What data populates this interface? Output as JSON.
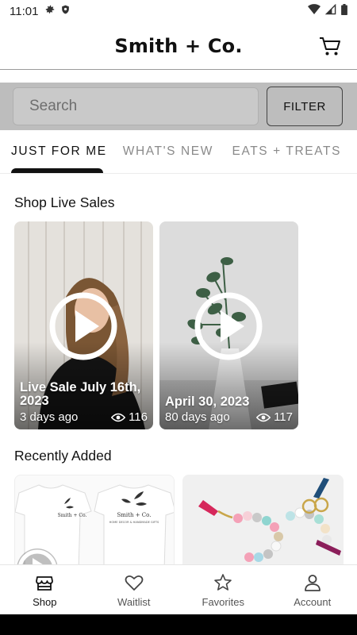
{
  "status_bar": {
    "time": "11:01",
    "left_icons": [
      "gear-icon",
      "shield-icon"
    ],
    "right_icons": [
      "wifi-icon",
      "signal-icon",
      "battery-icon"
    ]
  },
  "header": {
    "title": "Smith + Co.",
    "cart_icon": "cart-icon"
  },
  "search": {
    "placeholder": "Search",
    "filter_label": "FILTER"
  },
  "tabs": [
    {
      "label": "JUST FOR ME",
      "active": true
    },
    {
      "label": "WHAT'S NEW",
      "active": false
    },
    {
      "label": "EATS + TREATS",
      "active": false
    }
  ],
  "live_sales": {
    "title": "Shop Live Sales",
    "cards": [
      {
        "title": "Live Sale July 16th, 2023",
        "age": "3 days ago",
        "views": "116"
      },
      {
        "title": "April 30, 2023",
        "age": "80 days ago",
        "views": "117"
      }
    ]
  },
  "recently_added": {
    "title": "Recently Added",
    "product_1_print": "Smith + Co.",
    "product_1_subprint": "HOME DECOR & HANDMADE GIFTS"
  },
  "bottom_nav": [
    {
      "label": "Shop",
      "icon": "store-icon",
      "active": true
    },
    {
      "label": "Waitlist",
      "icon": "heart-icon",
      "active": false
    },
    {
      "label": "Favorites",
      "icon": "star-icon",
      "active": false
    },
    {
      "label": "Account",
      "icon": "person-icon",
      "active": false
    }
  ],
  "colors": {
    "search_bar_bg": "#bdbdbd",
    "tab_indicator": "#111111",
    "inactive_tab_text": "#8a8a8a"
  }
}
